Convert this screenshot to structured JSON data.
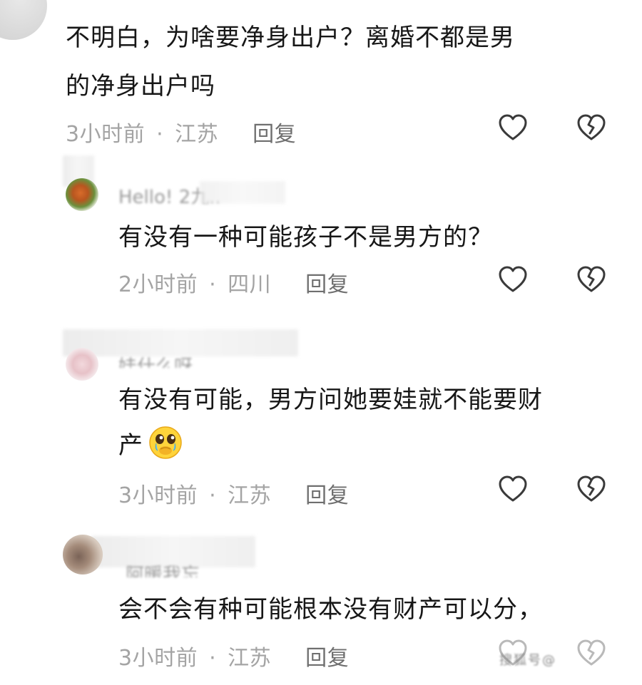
{
  "comments": [
    {
      "text_lines": [
        "不明白，为啥要净身出户？离婚不都是男",
        "的净身出户吗"
      ],
      "time": "3小时前",
      "dot": "·",
      "location": "江苏",
      "reply_label": "回复"
    },
    {
      "username": "Hello! 2九..",
      "text_lines": [
        "有没有一种可能孩子不是男方的？"
      ],
      "time": "2小时前",
      "dot": "·",
      "location": "四川",
      "reply_label": "回复"
    },
    {
      "username": "娃什么呀",
      "text_lines": [
        "有没有可能，男方问她要娃就不能要财",
        "产"
      ],
      "emoji": "crying-face-emoji",
      "time": "3小时前",
      "dot": "·",
      "location": "江苏",
      "reply_label": "回复"
    },
    {
      "username": "阿暖我忘",
      "text_lines": [
        "会不会有种可能根本没有财产可以分，"
      ],
      "time": "3小时前",
      "dot": "·",
      "location": "江苏",
      "reply_label": "回复"
    }
  ],
  "icons": {
    "like": "heart-outline-icon",
    "dislike": "broken-heart-outline-icon"
  },
  "colors": {
    "text": "#171717",
    "meta": "#a4a4a4",
    "reply": "#6f6f6f",
    "icon_stroke": "#3a3a3a"
  },
  "watermark": "搜狐号@"
}
